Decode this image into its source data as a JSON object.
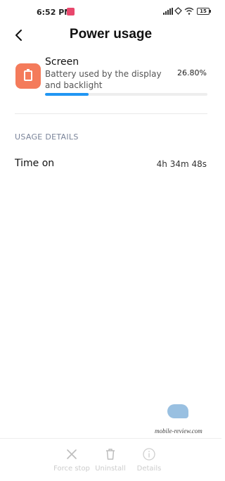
{
  "status_bar": {
    "time": "6:52 PM",
    "battery_level": "15",
    "icons": [
      "app-notification-icon",
      "signal-icon",
      "wifi-icon",
      "battery-icon"
    ]
  },
  "header": {
    "title": "Power usage",
    "back_icon": "back-chevron-icon"
  },
  "usage": {
    "name": "Screen",
    "description": "Battery used by the display and backlight",
    "percent_text": "26.80%",
    "percent_value": 0.268,
    "icon": "screen-battery-icon",
    "icon_color": "#f47b5b",
    "bar_color": "#2196f3"
  },
  "details": {
    "section_title": "USAGE DETAILS",
    "rows": [
      {
        "label": "Time on",
        "value": "4h 34m 48s"
      }
    ]
  },
  "watermark": {
    "text": "mobile-review.com"
  },
  "actions": [
    {
      "label": "Force stop",
      "icon": "close-icon",
      "enabled": false
    },
    {
      "label": "Uninstall",
      "icon": "trash-icon",
      "enabled": false
    },
    {
      "label": "Details",
      "icon": "info-icon",
      "enabled": false
    }
  ]
}
